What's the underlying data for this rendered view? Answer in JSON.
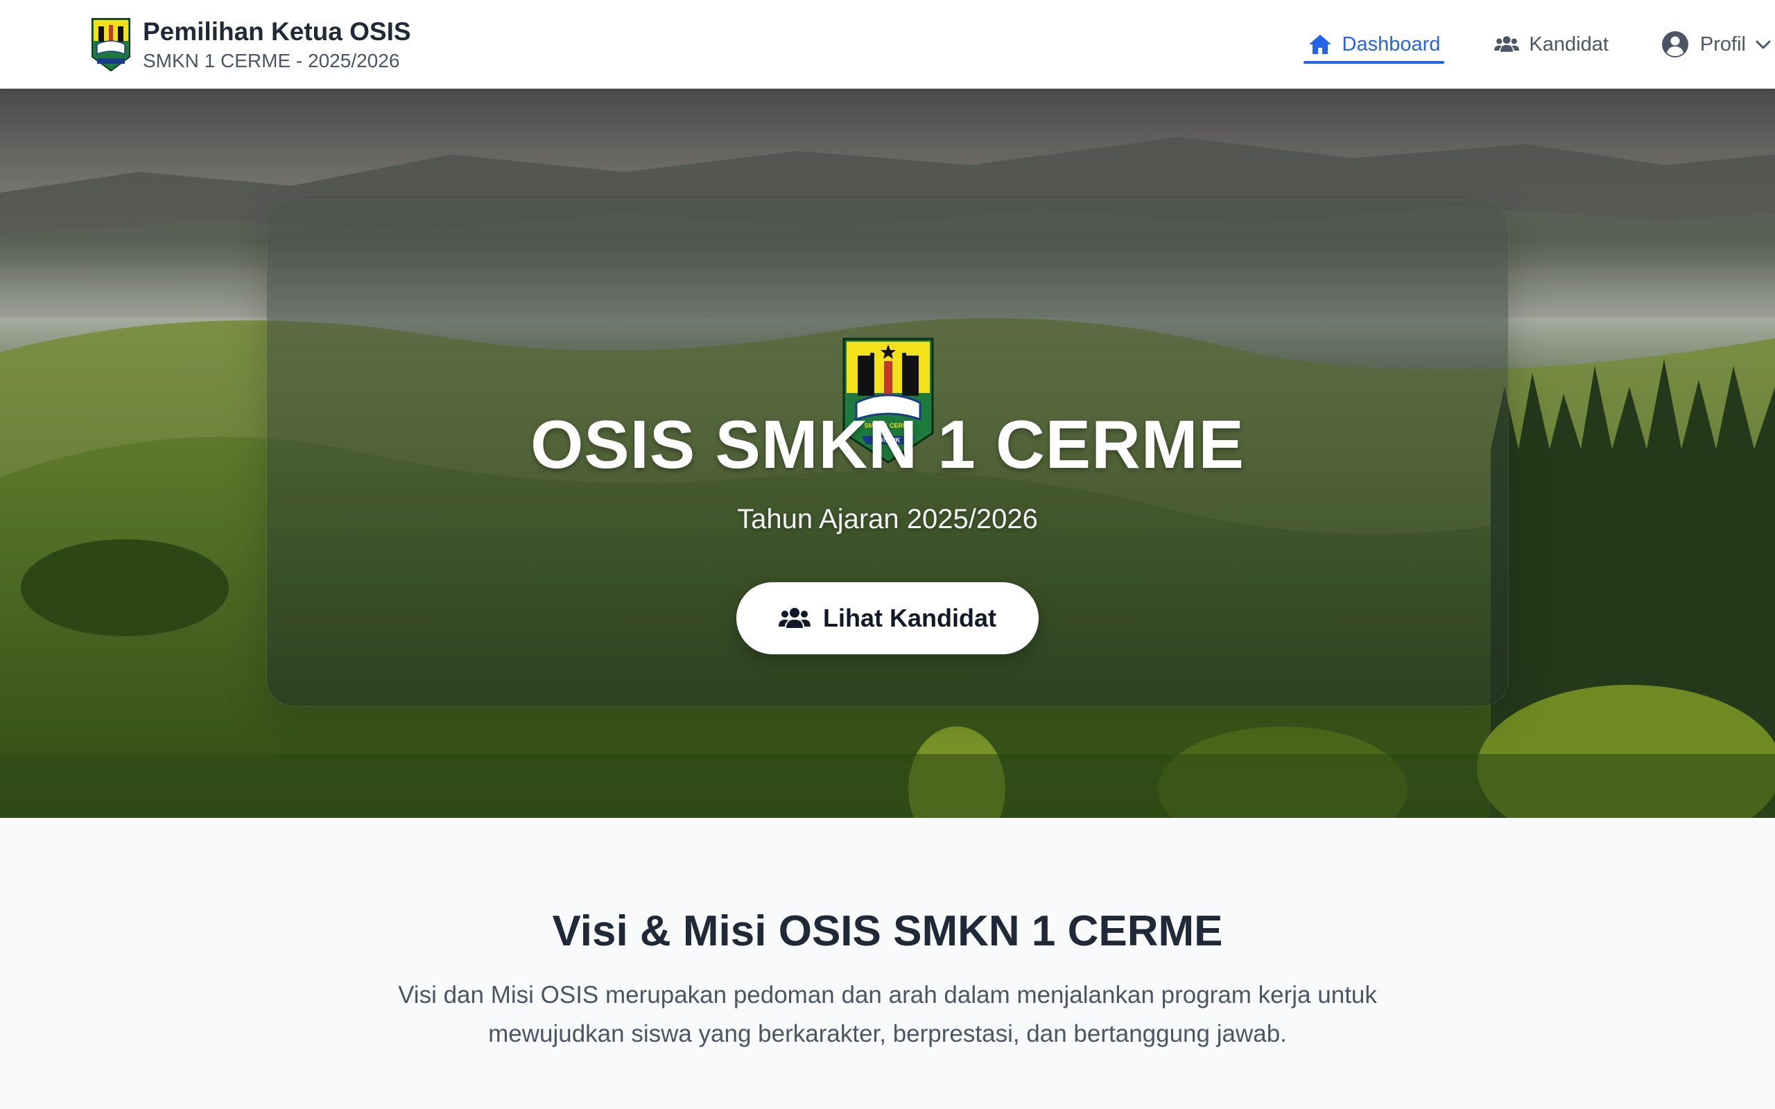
{
  "header": {
    "title": "Pemilihan Ketua OSIS",
    "subtitle": "SMKN 1 CERME - 2025/2026",
    "logo_icon": "school-crest-icon"
  },
  "nav": {
    "dashboard": {
      "label": "Dashboard",
      "icon": "home-icon",
      "active": true
    },
    "kandidat": {
      "label": "Kandidat",
      "icon": "users-icon"
    },
    "profil": {
      "label": "Profil",
      "icon": "user-circle-icon",
      "dropdown_icon": "chevron-down-icon"
    }
  },
  "hero": {
    "title": "OSIS SMKN 1 CERME",
    "subtitle": "Tahun Ajaran 2025/2026",
    "button": {
      "label": "Lihat Kandidat",
      "icon": "users-icon"
    },
    "crest_text_top": "SMKN 1 CERME",
    "crest_text_bottom": "GRESIK"
  },
  "section": {
    "title": "Visi & Misi OSIS SMKN 1 CERME",
    "description": "Visi dan Misi OSIS merupakan pedoman dan arah dalam menjalankan program kerja untuk mewujudkan siswa yang berkarakter, berprestasi, dan bertanggung jawab."
  },
  "colors": {
    "accent": "#2563eb",
    "text_dark": "#1f2937",
    "text_muted": "#4b5563",
    "page_bg": "#f8fafc"
  }
}
